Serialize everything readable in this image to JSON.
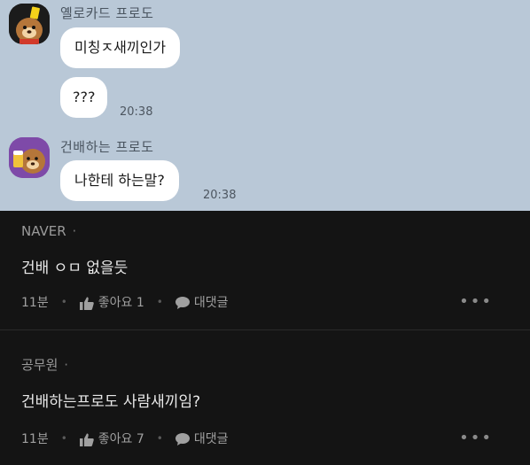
{
  "chat": {
    "messages_group_1": {
      "sender": "옐로카드 프로도",
      "bubbles": [
        "미칭ㅈ새끼인가",
        "???"
      ],
      "time": "20:38"
    },
    "messages_group_2": {
      "sender": "건배하는 프로도",
      "bubbles": [
        "나한테 하는말?"
      ],
      "time": "20:38"
    }
  },
  "comments": [
    {
      "author": "NAVER",
      "dot": "·",
      "text": "건배 ㅇㅁ 없을듯",
      "age": "11분",
      "like_label": "좋아요 1",
      "reply_label": "대댓글",
      "more": "•••"
    },
    {
      "author": "공무원",
      "dot": "·",
      "text": "건배하는프로도 사람새끼임?",
      "age": "11분",
      "like_label": "좋아요 7",
      "reply_label": "대댓글",
      "more": "•••"
    }
  ],
  "colors": {
    "chat_background": "#b9c8d7",
    "comment_background": "#141414",
    "bubble": "#ffffff"
  }
}
